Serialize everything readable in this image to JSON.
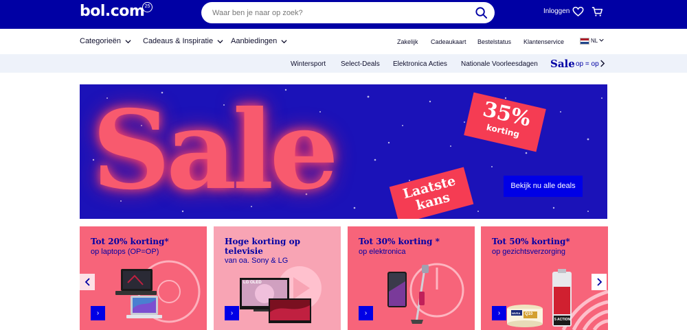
{
  "header": {
    "logo": "bol.com",
    "logo_badge": "25",
    "search_placeholder": "Waar ben je naar op zoek?",
    "login": "Inloggen"
  },
  "nav": {
    "categories": "Categorieën",
    "gifts": "Cadeaus & Inspiratie",
    "offers": "Aanbiedingen",
    "business": "Zakelijk",
    "giftcard": "Cadeaukaart",
    "order_status": "Bestelstatus",
    "customer_service": "Klantenservice",
    "language": "NL"
  },
  "subnav": {
    "items": [
      "Wintersport",
      "Select-Deals",
      "Elektronica Acties",
      "Nationale Voorleesdagen"
    ],
    "sale": "Sale",
    "sale_sub": "op = op"
  },
  "hero": {
    "title": "Sale",
    "badge_percent": "35%",
    "badge_label": "korting",
    "last_chance_line1": "Laatste",
    "last_chance_line2": "kans",
    "cta": "Bekijk nu alle deals"
  },
  "tiles": [
    {
      "title": "Tot 20% korting*",
      "subtitle": "op laptops (OP=OP)",
      "bg": "#f7647a",
      "arrow": "›"
    },
    {
      "title": "Hoge korting op televisie",
      "subtitle": "van oa. Sony & LG",
      "bg": "#f8a4b4",
      "arrow": "›",
      "tv_brand": "LG OLED"
    },
    {
      "title": "Tot 30% korting *",
      "subtitle": "op elektronica",
      "bg": "#f7647a",
      "arrow": "›"
    },
    {
      "title": "Tot 50% korting*",
      "subtitle": "op gezichtsverzorging",
      "bg": "#f7647a",
      "arrow": "›",
      "jar_brand": "NIVEA",
      "jar_text": "Q10",
      "bottle_text": "5 ACTION"
    }
  ],
  "colors": {
    "brand_blue": "#0000a4",
    "accent_blue": "#0000e6",
    "hero_bg": "#1b12b8",
    "sale_pink": "#f85a6e"
  }
}
